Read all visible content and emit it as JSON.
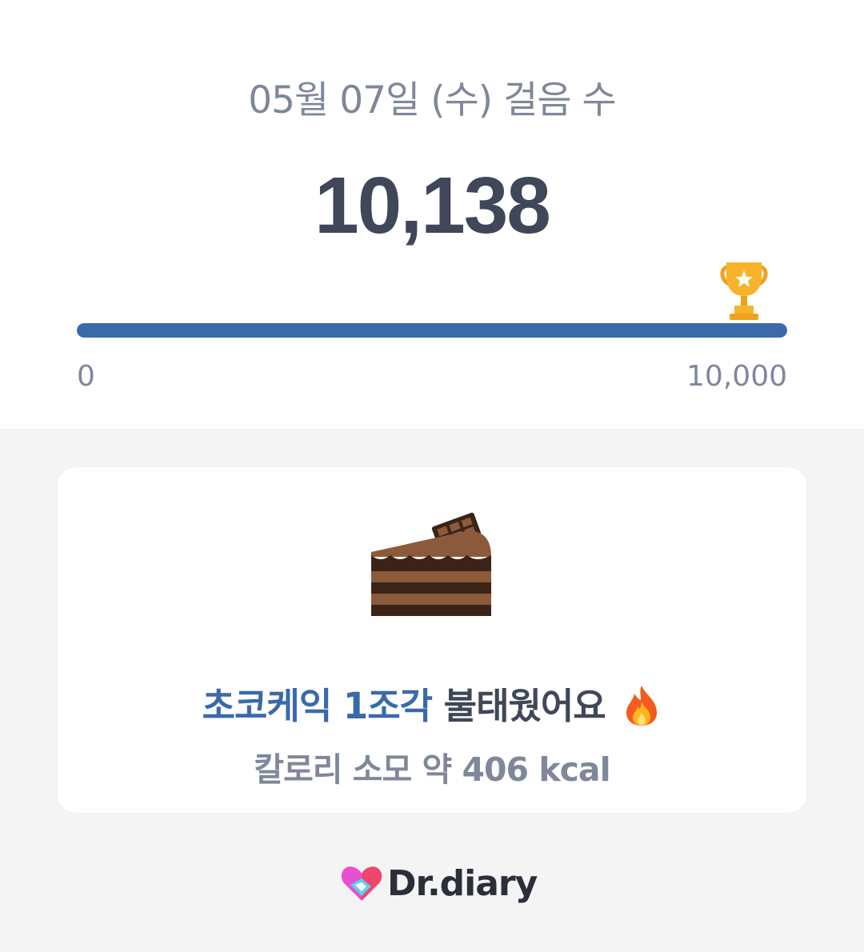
{
  "header": {
    "date_title": "05월 07일 (수) 걸음 수",
    "step_count": "10,138"
  },
  "progress": {
    "min_label": "0",
    "max_label": "10,000",
    "fraction": 1.0,
    "goal_icon": "trophy-icon",
    "fill_color": "#3b6aab"
  },
  "card": {
    "food_icon": "chocolate-cake-icon",
    "burn_highlight": "초코케익 1조각",
    "burn_rest": " 불태웠어요",
    "burn_emoji_icon": "fire-icon",
    "calorie_text": "칼로리 소모 약 406 kcal"
  },
  "footer": {
    "brand": "Dr.diary"
  },
  "colors": {
    "accent": "#3b6aab",
    "text_dark": "#3f4758",
    "text_muted": "#7f889a"
  }
}
